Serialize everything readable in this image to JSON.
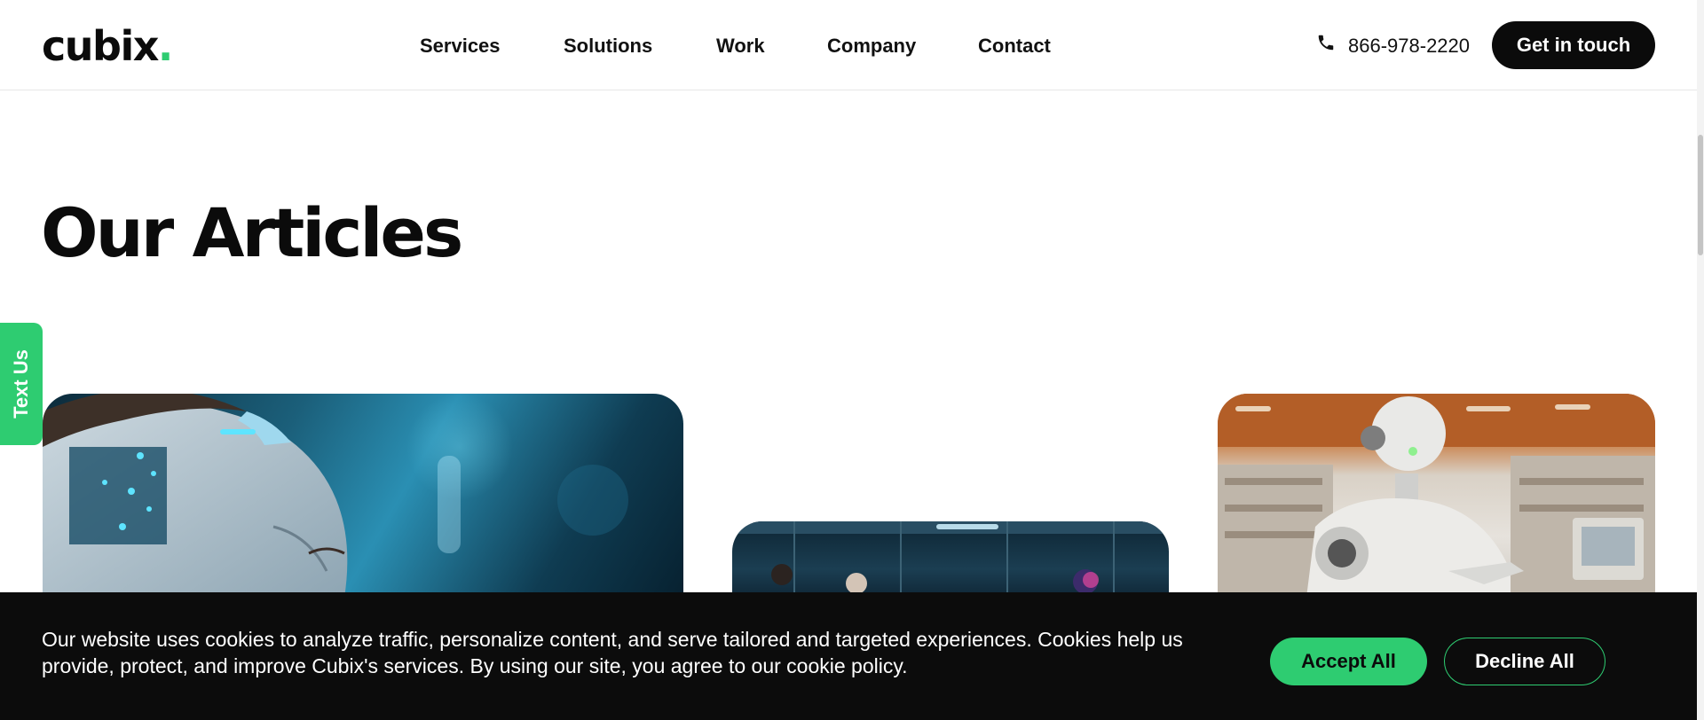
{
  "brand": {
    "name": "cubix",
    "dot": ".",
    "accent_color": "#2ecc71"
  },
  "nav": {
    "items": [
      {
        "label": "Services"
      },
      {
        "label": "Solutions"
      },
      {
        "label": "Work"
      },
      {
        "label": "Company"
      },
      {
        "label": "Contact"
      }
    ]
  },
  "header": {
    "phone_icon": "phone-icon",
    "phone": "866-978-2220",
    "cta_label": "Get in touch"
  },
  "main": {
    "title": "Our Articles",
    "text_us_label": "Text Us"
  },
  "cookie_banner": {
    "message": "Our website uses cookies to analyze traffic, personalize content, and serve tailored and targeted experiences. Cookies help us provide, protect, and improve Cubix's services. By using our site, you agree to our cookie policy.",
    "accept_label": "Accept All",
    "decline_label": "Decline All"
  }
}
